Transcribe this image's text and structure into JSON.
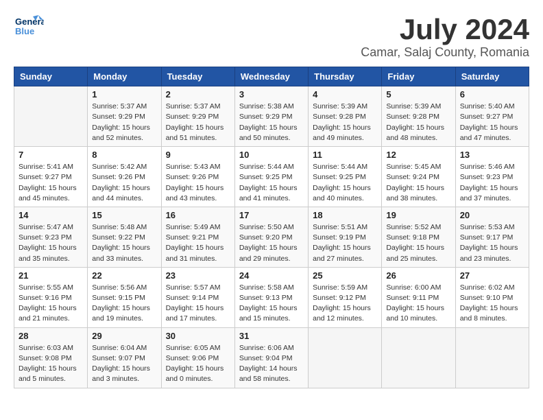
{
  "header": {
    "logo_line1": "General",
    "logo_line2": "Blue",
    "month": "July 2024",
    "location": "Camar, Salaj County, Romania"
  },
  "days_of_week": [
    "Sunday",
    "Monday",
    "Tuesday",
    "Wednesday",
    "Thursday",
    "Friday",
    "Saturday"
  ],
  "weeks": [
    [
      {
        "day": "",
        "info": ""
      },
      {
        "day": "1",
        "info": "Sunrise: 5:37 AM\nSunset: 9:29 PM\nDaylight: 15 hours\nand 52 minutes."
      },
      {
        "day": "2",
        "info": "Sunrise: 5:37 AM\nSunset: 9:29 PM\nDaylight: 15 hours\nand 51 minutes."
      },
      {
        "day": "3",
        "info": "Sunrise: 5:38 AM\nSunset: 9:29 PM\nDaylight: 15 hours\nand 50 minutes."
      },
      {
        "day": "4",
        "info": "Sunrise: 5:39 AM\nSunset: 9:28 PM\nDaylight: 15 hours\nand 49 minutes."
      },
      {
        "day": "5",
        "info": "Sunrise: 5:39 AM\nSunset: 9:28 PM\nDaylight: 15 hours\nand 48 minutes."
      },
      {
        "day": "6",
        "info": "Sunrise: 5:40 AM\nSunset: 9:27 PM\nDaylight: 15 hours\nand 47 minutes."
      }
    ],
    [
      {
        "day": "7",
        "info": "Sunrise: 5:41 AM\nSunset: 9:27 PM\nDaylight: 15 hours\nand 45 minutes."
      },
      {
        "day": "8",
        "info": "Sunrise: 5:42 AM\nSunset: 9:26 PM\nDaylight: 15 hours\nand 44 minutes."
      },
      {
        "day": "9",
        "info": "Sunrise: 5:43 AM\nSunset: 9:26 PM\nDaylight: 15 hours\nand 43 minutes."
      },
      {
        "day": "10",
        "info": "Sunrise: 5:44 AM\nSunset: 9:25 PM\nDaylight: 15 hours\nand 41 minutes."
      },
      {
        "day": "11",
        "info": "Sunrise: 5:44 AM\nSunset: 9:25 PM\nDaylight: 15 hours\nand 40 minutes."
      },
      {
        "day": "12",
        "info": "Sunrise: 5:45 AM\nSunset: 9:24 PM\nDaylight: 15 hours\nand 38 minutes."
      },
      {
        "day": "13",
        "info": "Sunrise: 5:46 AM\nSunset: 9:23 PM\nDaylight: 15 hours\nand 37 minutes."
      }
    ],
    [
      {
        "day": "14",
        "info": "Sunrise: 5:47 AM\nSunset: 9:23 PM\nDaylight: 15 hours\nand 35 minutes."
      },
      {
        "day": "15",
        "info": "Sunrise: 5:48 AM\nSunset: 9:22 PM\nDaylight: 15 hours\nand 33 minutes."
      },
      {
        "day": "16",
        "info": "Sunrise: 5:49 AM\nSunset: 9:21 PM\nDaylight: 15 hours\nand 31 minutes."
      },
      {
        "day": "17",
        "info": "Sunrise: 5:50 AM\nSunset: 9:20 PM\nDaylight: 15 hours\nand 29 minutes."
      },
      {
        "day": "18",
        "info": "Sunrise: 5:51 AM\nSunset: 9:19 PM\nDaylight: 15 hours\nand 27 minutes."
      },
      {
        "day": "19",
        "info": "Sunrise: 5:52 AM\nSunset: 9:18 PM\nDaylight: 15 hours\nand 25 minutes."
      },
      {
        "day": "20",
        "info": "Sunrise: 5:53 AM\nSunset: 9:17 PM\nDaylight: 15 hours\nand 23 minutes."
      }
    ],
    [
      {
        "day": "21",
        "info": "Sunrise: 5:55 AM\nSunset: 9:16 PM\nDaylight: 15 hours\nand 21 minutes."
      },
      {
        "day": "22",
        "info": "Sunrise: 5:56 AM\nSunset: 9:15 PM\nDaylight: 15 hours\nand 19 minutes."
      },
      {
        "day": "23",
        "info": "Sunrise: 5:57 AM\nSunset: 9:14 PM\nDaylight: 15 hours\nand 17 minutes."
      },
      {
        "day": "24",
        "info": "Sunrise: 5:58 AM\nSunset: 9:13 PM\nDaylight: 15 hours\nand 15 minutes."
      },
      {
        "day": "25",
        "info": "Sunrise: 5:59 AM\nSunset: 9:12 PM\nDaylight: 15 hours\nand 12 minutes."
      },
      {
        "day": "26",
        "info": "Sunrise: 6:00 AM\nSunset: 9:11 PM\nDaylight: 15 hours\nand 10 minutes."
      },
      {
        "day": "27",
        "info": "Sunrise: 6:02 AM\nSunset: 9:10 PM\nDaylight: 15 hours\nand 8 minutes."
      }
    ],
    [
      {
        "day": "28",
        "info": "Sunrise: 6:03 AM\nSunset: 9:08 PM\nDaylight: 15 hours\nand 5 minutes."
      },
      {
        "day": "29",
        "info": "Sunrise: 6:04 AM\nSunset: 9:07 PM\nDaylight: 15 hours\nand 3 minutes."
      },
      {
        "day": "30",
        "info": "Sunrise: 6:05 AM\nSunset: 9:06 PM\nDaylight: 15 hours\nand 0 minutes."
      },
      {
        "day": "31",
        "info": "Sunrise: 6:06 AM\nSunset: 9:04 PM\nDaylight: 14 hours\nand 58 minutes."
      },
      {
        "day": "",
        "info": ""
      },
      {
        "day": "",
        "info": ""
      },
      {
        "day": "",
        "info": ""
      }
    ]
  ]
}
